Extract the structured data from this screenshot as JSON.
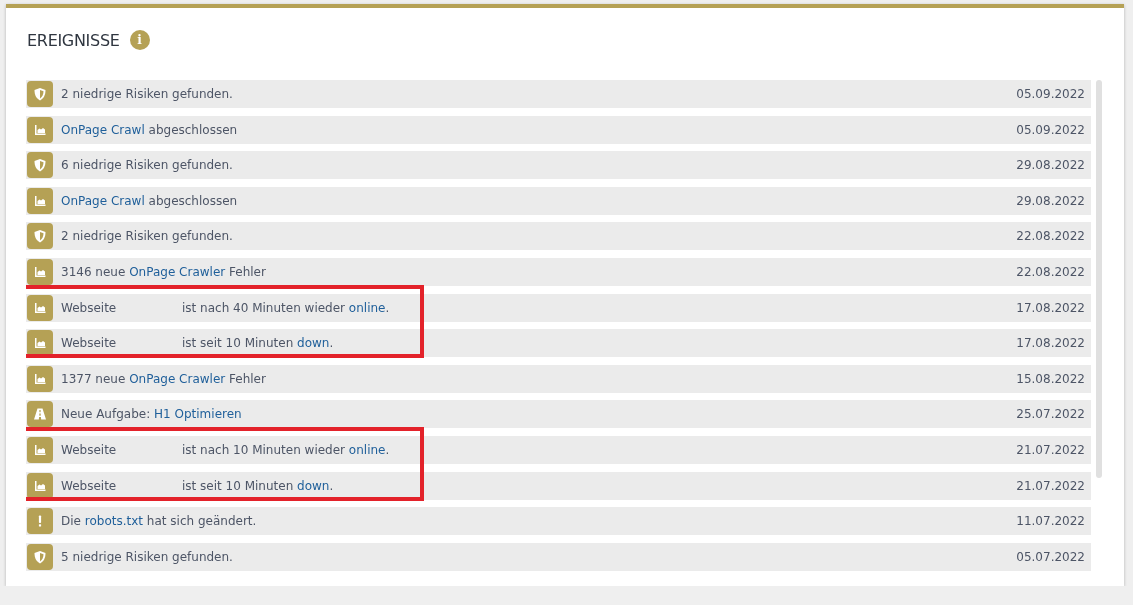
{
  "panel": {
    "title": "EREIGNISSE",
    "info_icon": "i"
  },
  "events": [
    {
      "kind": "risk",
      "highlight": false,
      "date": "05.09.2022",
      "parts": [
        {
          "text": "2 niedrige Risiken gefunden.",
          "link": false
        }
      ]
    },
    {
      "kind": "crawl",
      "highlight": false,
      "date": "05.09.2022",
      "parts": [
        {
          "text": "OnPage Crawl",
          "link": true
        },
        {
          "text": " abgeschlossen",
          "link": false
        }
      ]
    },
    {
      "kind": "risk",
      "highlight": false,
      "date": "29.08.2022",
      "parts": [
        {
          "text": "6 niedrige Risiken gefunden.",
          "link": false
        }
      ]
    },
    {
      "kind": "crawl",
      "highlight": false,
      "date": "29.08.2022",
      "parts": [
        {
          "text": "OnPage Crawl",
          "link": true
        },
        {
          "text": " abgeschlossen",
          "link": false
        }
      ]
    },
    {
      "kind": "risk",
      "highlight": false,
      "date": "22.08.2022",
      "parts": [
        {
          "text": "2 niedrige Risiken gefunden.",
          "link": false
        }
      ]
    },
    {
      "kind": "crawl",
      "highlight": false,
      "date": "22.08.2022",
      "parts": [
        {
          "text": "3146 neue ",
          "link": false
        },
        {
          "text": "OnPage Crawler",
          "link": true
        },
        {
          "text": " Fehler",
          "link": false
        }
      ]
    },
    {
      "kind": "crawl",
      "highlight": true,
      "date": "17.08.2022",
      "subject": "Webseite",
      "parts": [
        {
          "text": "ist nach 40 Minuten wieder ",
          "link": false
        },
        {
          "text": "online",
          "link": true
        },
        {
          "text": ".",
          "link": false
        }
      ]
    },
    {
      "kind": "crawl",
      "highlight": true,
      "date": "17.08.2022",
      "subject": "Webseite",
      "parts": [
        {
          "text": "ist seit 10 Minuten ",
          "link": false
        },
        {
          "text": "down",
          "link": true
        },
        {
          "text": ".",
          "link": false
        }
      ]
    },
    {
      "kind": "crawl",
      "highlight": false,
      "date": "15.08.2022",
      "parts": [
        {
          "text": "1377 neue ",
          "link": false
        },
        {
          "text": "OnPage Crawler",
          "link": true
        },
        {
          "text": " Fehler",
          "link": false
        }
      ]
    },
    {
      "kind": "task",
      "highlight": false,
      "date": "25.07.2022",
      "parts": [
        {
          "text": "Neue Aufgabe: ",
          "link": false
        },
        {
          "text": "H1 Optimieren",
          "link": true
        }
      ]
    },
    {
      "kind": "crawl",
      "highlight": true,
      "date": "21.07.2022",
      "subject": "Webseite",
      "parts": [
        {
          "text": "ist nach 10 Minuten wieder ",
          "link": false
        },
        {
          "text": "online",
          "link": true
        },
        {
          "text": ".",
          "link": false
        }
      ]
    },
    {
      "kind": "crawl",
      "highlight": true,
      "date": "21.07.2022",
      "subject": "Webseite",
      "parts": [
        {
          "text": "ist seit 10 Minuten ",
          "link": false
        },
        {
          "text": "down",
          "link": true
        },
        {
          "text": ".",
          "link": false
        }
      ]
    },
    {
      "kind": "alert",
      "highlight": false,
      "date": "11.07.2022",
      "parts": [
        {
          "text": "Die ",
          "link": false
        },
        {
          "text": "robots.txt",
          "link": true
        },
        {
          "text": " hat sich geändert.",
          "link": false
        }
      ]
    },
    {
      "kind": "risk",
      "highlight": false,
      "date": "05.07.2022",
      "parts": [
        {
          "text": "5 niedrige Risiken gefunden.",
          "link": false
        }
      ]
    }
  ]
}
